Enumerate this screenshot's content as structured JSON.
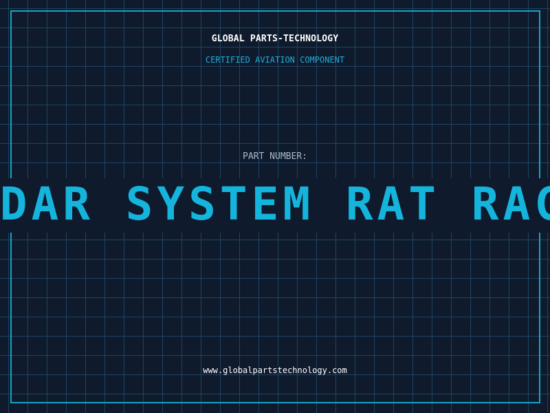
{
  "header": {
    "brand_name": "GLOBAL PARTS-TECHNOLOGY",
    "tagline": "CERTIFIED AVIATION COMPONENT"
  },
  "part": {
    "label": "PART NUMBER:",
    "number_visible": "ADAR SYSTEM RAT RAC"
  },
  "footer": {
    "url": "www.globalpartstechnology.com"
  },
  "colors": {
    "background": "#0f1a2c",
    "grid": "#1d4661",
    "accent": "#1aa3c8",
    "marquee_text": "#14b4dc",
    "label_text": "#a9bccd",
    "white_text": "#ffffff"
  }
}
